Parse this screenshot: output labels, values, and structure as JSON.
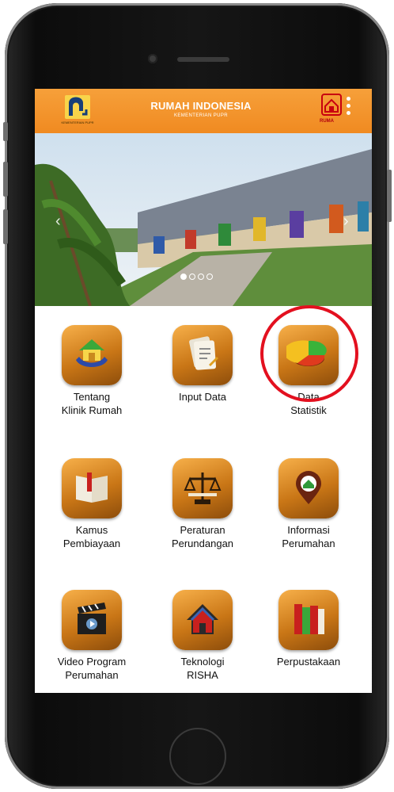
{
  "header": {
    "title": "RUMAH INDONESIA",
    "subtitle": "KEMENTERIAN PUPR",
    "logo_caption": "KEMENTERIAN PUPR",
    "right_logo_text": "RUMA"
  },
  "banner": {
    "pager_count": 4,
    "active_index": 0
  },
  "menu": {
    "items": [
      {
        "label_line1": "Tentang",
        "label_line2": "Klinik Rumah",
        "icon": "house-hands-icon"
      },
      {
        "label_line1": "Input Data",
        "label_line2": "",
        "icon": "clipboard-pen-icon"
      },
      {
        "label_line1": "Data",
        "label_line2": "Statistik",
        "icon": "pie-chart-icon"
      },
      {
        "label_line1": "Kamus",
        "label_line2": "Pembiayaan",
        "icon": "book-icon"
      },
      {
        "label_line1": "Peraturan",
        "label_line2": "Perundangan",
        "icon": "scales-icon"
      },
      {
        "label_line1": "Informasi",
        "label_line2": "Perumahan",
        "icon": "map-pin-house-icon"
      },
      {
        "label_line1": "Video Program",
        "label_line2": "Perumahan",
        "icon": "clapperboard-icon"
      },
      {
        "label_line1": "Teknologi",
        "label_line2": "RISHA",
        "icon": "house-frame-icon"
      },
      {
        "label_line1": "Perpustakaan",
        "label_line2": "",
        "icon": "books-icon"
      }
    ]
  },
  "colors": {
    "accent": "#f08a21",
    "highlight": "#e3101f"
  }
}
